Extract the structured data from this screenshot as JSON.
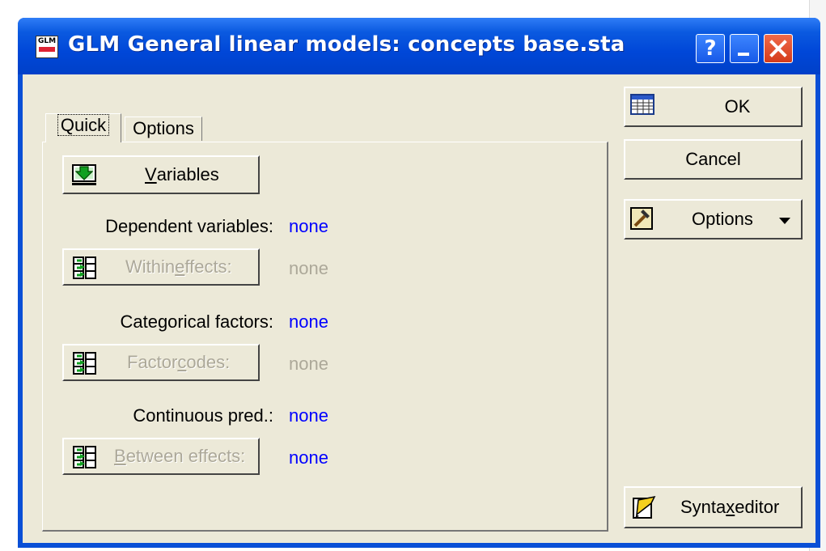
{
  "window": {
    "icon_text": "GLM",
    "title": "GLM General linear models: concepts base.sta",
    "help_label": "?"
  },
  "tabs": [
    {
      "label": "Quick",
      "active": true
    },
    {
      "label": "Options",
      "active": false
    }
  ],
  "quick": {
    "variables_button": {
      "pre": "",
      "ul": "V",
      "post": "ariables"
    },
    "dependent": {
      "label": "Dependent variables:",
      "value": "none"
    },
    "within_button": {
      "pre": "Within ",
      "ul": "e",
      "post": "ffects:",
      "enabled": false,
      "value": "none"
    },
    "categorical": {
      "label": "Categorical factors:",
      "value": "none"
    },
    "factor_codes_button": {
      "pre": "Factor ",
      "ul": "c",
      "post": "odes:",
      "enabled": false,
      "value": "none"
    },
    "continuous": {
      "label": "Continuous pred.:",
      "value": "none"
    },
    "between_button": {
      "pre": "",
      "ul": "B",
      "post": "etween effects:",
      "enabled": false,
      "value": "none"
    }
  },
  "side_buttons": {
    "ok": "OK",
    "cancel": "Cancel",
    "options": "Options",
    "syntax": {
      "pre": "Synta",
      "ul": "x",
      "post": " editor"
    }
  },
  "colors": {
    "titlebar": "#0047d8",
    "dialog_face": "#ece9d8",
    "value_blue": "#0000ff",
    "disabled_text": "#aca899"
  },
  "icons": {
    "window": "glm-app-icon",
    "variables": "variables-select-icon",
    "effects": "effects-grid-icon",
    "ok": "spreadsheet-icon",
    "options": "options-hammer-icon",
    "syntax": "syntax-edit-icon"
  }
}
